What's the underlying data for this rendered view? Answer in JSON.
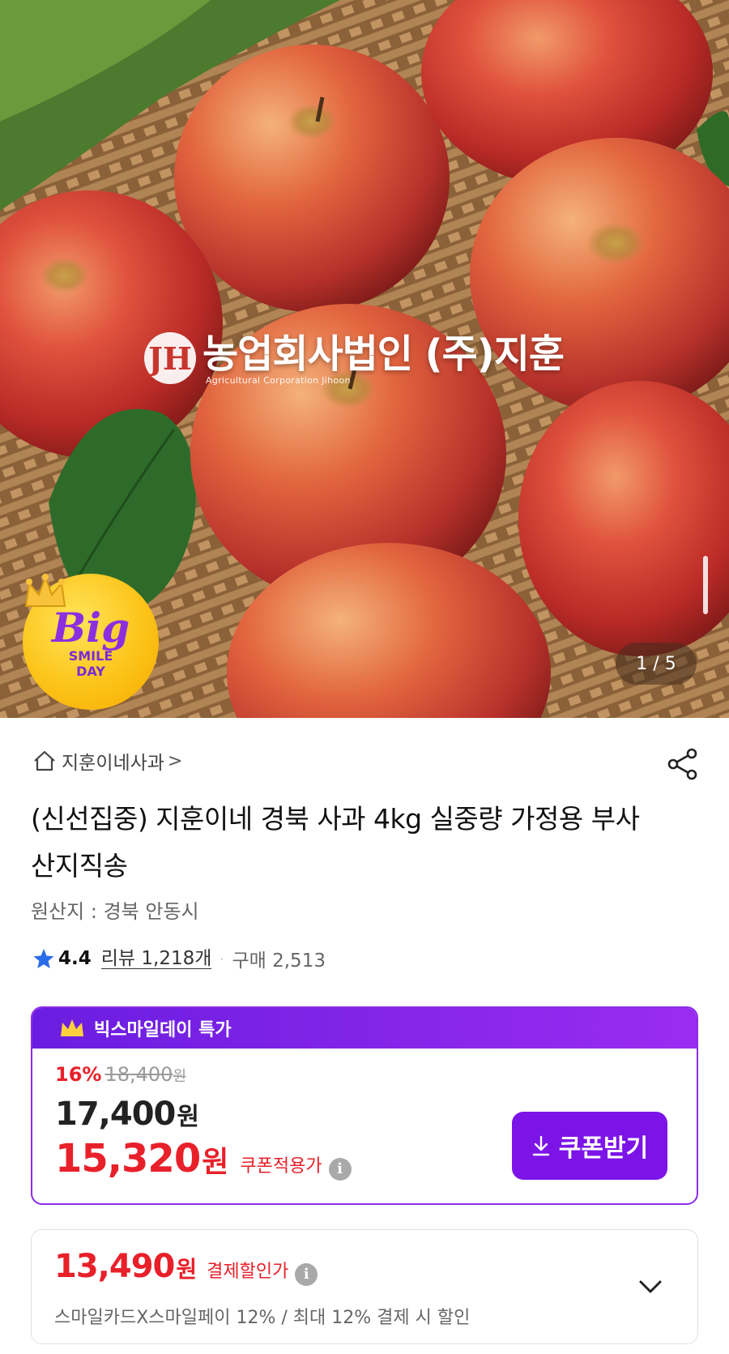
{
  "hero": {
    "watermark_logo": "JH",
    "watermark_main": "농업회사법인 (주)지훈",
    "watermark_sub": "Agricultural Corporation Jihoon",
    "badge_big": "Big",
    "badge_line1": "SMILE",
    "badge_line2": "DAY",
    "image_counter": "1 / 5"
  },
  "product": {
    "seller_name": "지훈이네사과",
    "seller_chevron": ">",
    "title": "(신선집중) 지훈이네 경북 사과 4kg 실중량 가정용 부사 산지직송",
    "origin": "원산지 : 경북 안동시",
    "rating": "4.4",
    "reviews": "리뷰 1,218개",
    "separator": "·",
    "purchases": "구매 2,513"
  },
  "deal": {
    "header": "빅스마일데이 특가",
    "discount": "16%",
    "original_price": "18,400",
    "original_unit": "원",
    "price": "17,400",
    "price_unit": "원",
    "coupon_price": "15,320",
    "coupon_unit": "원",
    "coupon_label": "쿠폰적용가",
    "info": "i",
    "coupon_button": "쿠폰받기"
  },
  "payment": {
    "price": "13,490",
    "unit": "원",
    "label": "결제할인가",
    "info": "i",
    "description": "스마일카드X스마일페이 12% / 최대 12% 결제 시 할인"
  },
  "colors": {
    "accent_purple": "#7c14e8",
    "sale_red": "#e8202a",
    "badge_yellow": "#fcc419"
  },
  "icons": [
    "home-icon",
    "share-icon",
    "star-icon",
    "crown-icon",
    "download-icon",
    "info-icon",
    "chevron-down-icon"
  ]
}
